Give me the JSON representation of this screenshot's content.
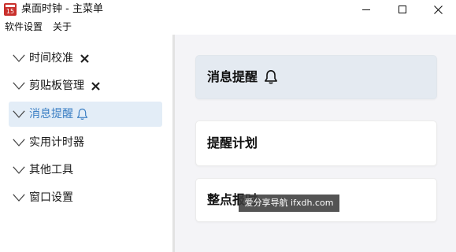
{
  "window": {
    "title": "桌面时钟 - 主菜单",
    "icon_number": "15"
  },
  "menubar": {
    "settings": "软件设置",
    "about": "关于"
  },
  "sidebar": {
    "items": [
      {
        "label": "时间校准",
        "icon": "close-icon"
      },
      {
        "label": "剪贴板管理",
        "icon": "close-icon"
      },
      {
        "label": "消息提醒",
        "icon": "bell-icon",
        "selected": true
      },
      {
        "label": "实用计时器"
      },
      {
        "label": "其他工具"
      },
      {
        "label": "窗口设置"
      }
    ]
  },
  "main": {
    "header_title": "消息提醒",
    "cards": [
      {
        "title": "提醒计划"
      },
      {
        "title": "整点报时"
      }
    ]
  },
  "watermark": "爱分享导航 ifxdh.com",
  "colors": {
    "accent": "#3b7fc4",
    "selected_bg": "#e3edf7",
    "header_card_bg": "#e4eaf1",
    "main_bg": "#f4f4f7"
  }
}
